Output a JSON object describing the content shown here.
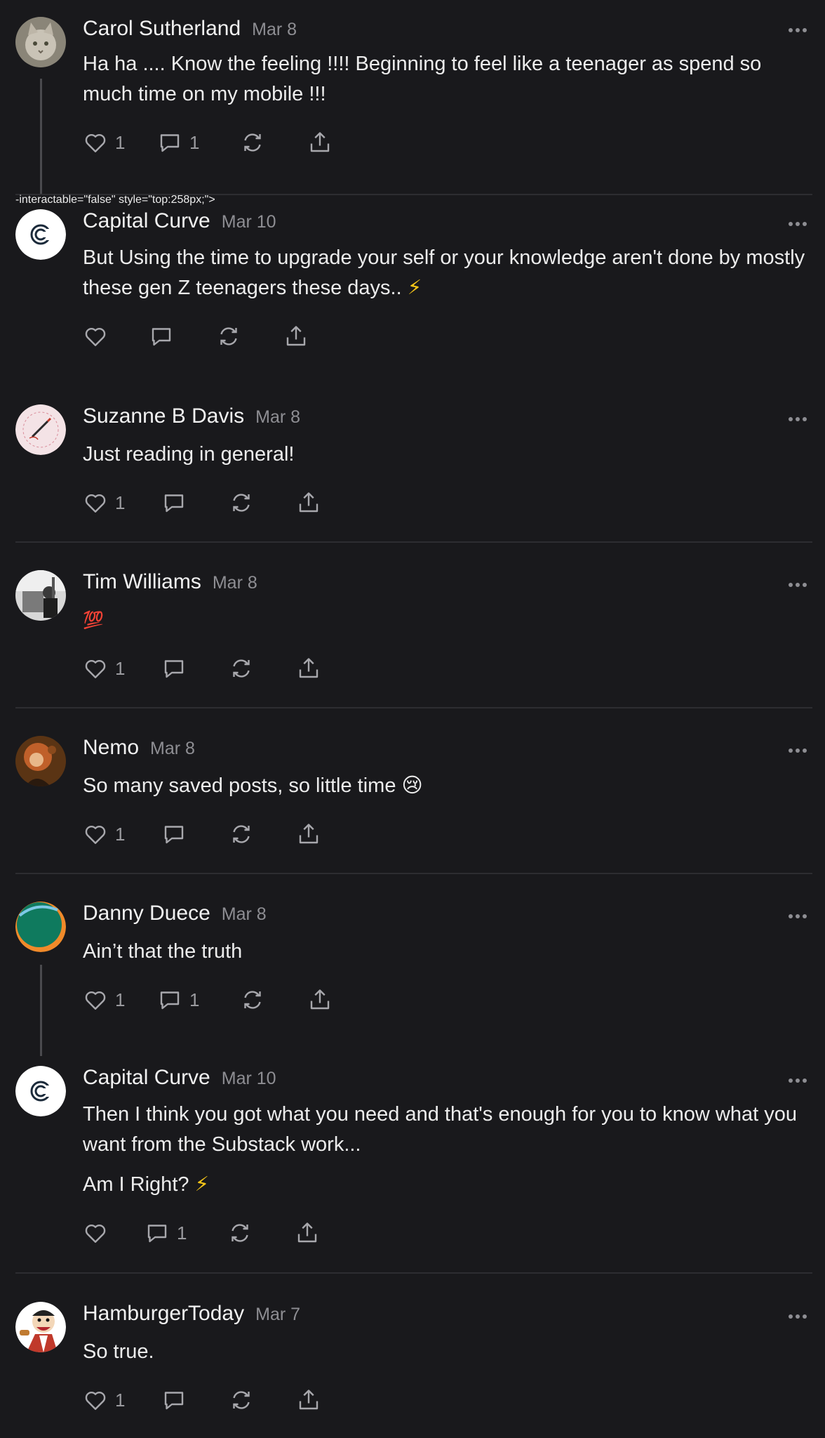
{
  "comments": [
    {
      "author": "Carol Sutherland",
      "date": "Mar 8",
      "paragraphs": [
        "Ha ha .... Know the feeling !!!! Beginning to feel like a teenager as spend so much time on my mobile !!!"
      ],
      "likes": "1",
      "replies": "1",
      "avatar_icon": "cat-photo-avatar"
    },
    {
      "author": "Capital Curve",
      "date": "Mar 10",
      "paragraphs": [
        "But Using the time to upgrade your self or your knowledge aren't done by mostly these gen Z teenagers these days.. ⚡"
      ],
      "likes": "",
      "replies": "",
      "avatar_icon": "capital-curve-logo"
    },
    {
      "author": "Suzanne B Davis",
      "date": "Mar 8",
      "paragraphs": [
        "Just reading in general!"
      ],
      "likes": "1",
      "replies": "",
      "avatar_icon": "someone-to-talk-to-logo"
    },
    {
      "author": "Tim Williams",
      "date": "Mar 8",
      "paragraphs": [
        "💯"
      ],
      "likes": "1",
      "replies": "",
      "avatar_icon": "grayscale-photo-avatar"
    },
    {
      "author": "Nemo",
      "date": "Mar 8",
      "paragraphs": [
        "So many saved posts, so little time 😢"
      ],
      "likes": "1",
      "replies": "",
      "avatar_icon": "painting-avatar"
    },
    {
      "author": "Danny Duece",
      "date": "Mar 8",
      "paragraphs": [
        "Ain’t that the truth"
      ],
      "likes": "1",
      "replies": "1",
      "avatar_icon": "green-circle-avatar"
    },
    {
      "author": "Capital Curve",
      "date": "Mar 10",
      "paragraphs": [
        "Then I think you got what you need and that's enough for you to know what you want from the Substack work...",
        "Am I Right? ⚡"
      ],
      "likes": "",
      "replies": "1",
      "avatar_icon": "capital-curve-logo"
    },
    {
      "author": "HamburgerToday",
      "date": "Mar 7",
      "paragraphs": [
        "So true."
      ],
      "likes": "1",
      "replies": "",
      "avatar_icon": "cartoon-chef-avatar"
    }
  ],
  "icons": {
    "like": "heart-icon",
    "reply": "comment-bubble-icon",
    "restack": "restack-icon",
    "share": "share-icon",
    "more": "more-options-icon"
  },
  "colors": {
    "background": "#19191c",
    "text": "#ececec",
    "muted": "#8e8e93",
    "divider": "#2d2d31"
  }
}
